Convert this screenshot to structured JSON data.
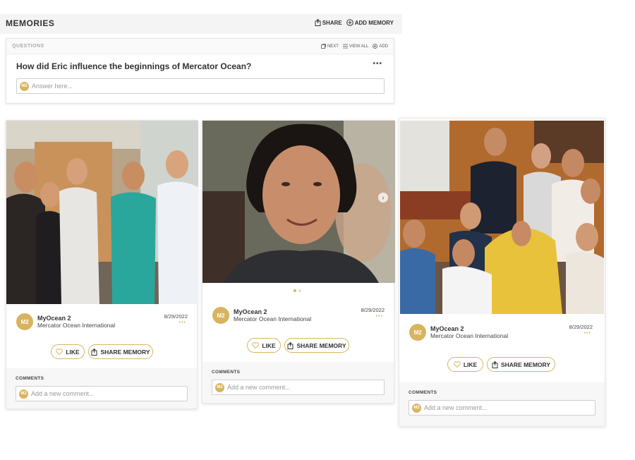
{
  "header": {
    "title": "MEMORIES",
    "share_label": "SHARE",
    "add_memory_label": "ADD MEMORY"
  },
  "questions": {
    "label": "QUESTIONS",
    "next_label": "NEXT",
    "view_all_label": "VIEW ALL",
    "add_label": "ADD",
    "question": "How did Eric influence the beginnings of Mercator Ocean?",
    "more": "•••",
    "answer_placeholder": "Answer here...",
    "user_initials": "M2"
  },
  "cards": [
    {
      "author_initials": "M2",
      "author": "MyOcean 2",
      "organization": "Mercator Ocean International",
      "date": "8/29/2022",
      "more": "•••",
      "like_label": "LIKE",
      "share_label": "SHARE MEMORY",
      "comments_label": "COMMENTS",
      "comment_placeholder": "Add a new comment...",
      "comment_initials": "M2",
      "photo": "group-photo-office"
    },
    {
      "author_initials": "M2",
      "author": "MyOcean 2",
      "organization": "Mercator Ocean International",
      "date": "8/29/2022",
      "more": "•••",
      "like_label": "LIKE",
      "share_label": "SHARE MEMORY",
      "comments_label": "COMMENTS",
      "comment_placeholder": "Add a new comment...",
      "comment_initials": "M2",
      "photo": "portrait-photo",
      "carousel_total": 2,
      "carousel_active": 1
    },
    {
      "author_initials": "M2",
      "author": "MyOcean 2",
      "organization": "Mercator Ocean International",
      "date": "8/29/2022",
      "more": "•••",
      "like_label": "LIKE",
      "share_label": "SHARE MEMORY",
      "comments_label": "COMMENTS",
      "comment_placeholder": "Add a new comment...",
      "comment_initials": "M2",
      "photo": "group-photo-home"
    }
  ],
  "colors": {
    "accent": "#d8b45f",
    "panel_bg": "#f4f4f4"
  }
}
